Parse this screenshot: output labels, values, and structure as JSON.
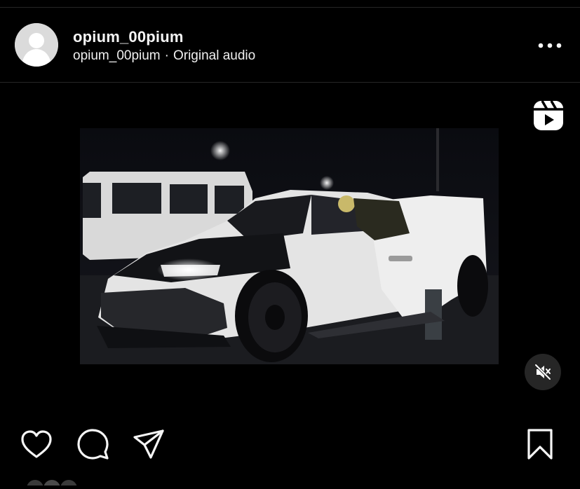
{
  "post": {
    "username": "opium_00pium",
    "audio_owner": "opium_00pium",
    "separator": "·",
    "audio_label": "Original audio"
  },
  "icons": {
    "avatar": "default-avatar-icon",
    "more": "more-horizontal-icon",
    "reels": "reels-icon",
    "mute": "muted-speaker-icon",
    "like": "heart-icon",
    "comment": "comment-bubble-icon",
    "share": "paper-plane-icon",
    "save": "bookmark-icon"
  },
  "colors": {
    "background": "#000000",
    "text": "#f5f5f5",
    "divider": "#262626",
    "mute_button": "#262626",
    "avatar_bg": "#dbdbdb"
  }
}
